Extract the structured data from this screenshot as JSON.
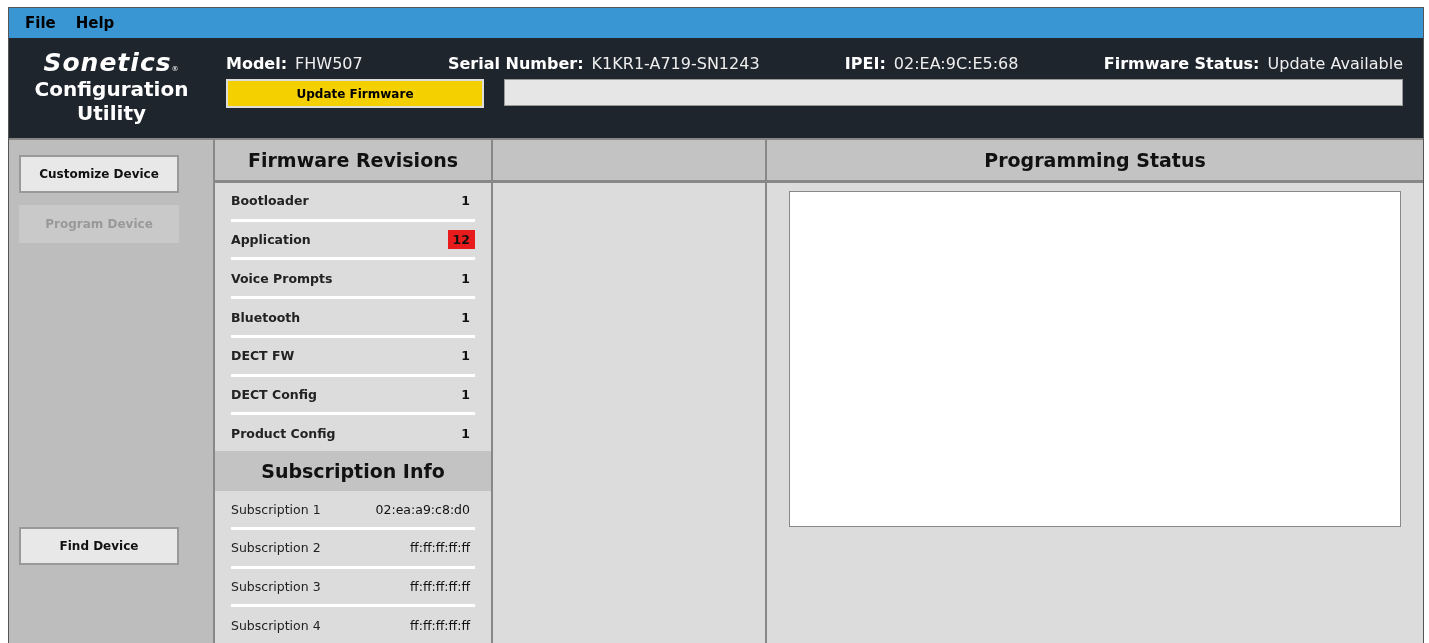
{
  "menu": [
    {
      "label": "File"
    },
    {
      "label": "Help"
    }
  ],
  "header": {
    "brand": "Sonetics",
    "brand_mark": "®",
    "subtitle": "Configuration Utility",
    "fields": [
      {
        "label": "Model:",
        "value": "FHW507"
      },
      {
        "label": "Serial Number:",
        "value": "K1KR1-A719-SN1243"
      },
      {
        "label": "IPEI:",
        "value": "02:EA:9C:E5:68"
      },
      {
        "label": "Firmware Status:",
        "value": "Update Available"
      }
    ],
    "update_button": {
      "label": "Update Firmware"
    },
    "progress": {
      "level": 0
    }
  },
  "sidebar": {
    "buttons": [
      {
        "label": "Customize Device",
        "disabled": false
      },
      {
        "label": "Program Device",
        "disabled": true
      }
    ],
    "find_button": {
      "label": "Find Device",
      "disabled": false
    }
  },
  "firmware": {
    "title": "Firmware Revisions",
    "rows": [
      {
        "name": "Bootloader",
        "value": "1",
        "outdated": false
      },
      {
        "name": "Application",
        "value": "12",
        "outdated": true
      },
      {
        "name": "Voice Prompts",
        "value": "1",
        "outdated": false
      },
      {
        "name": "Bluetooth",
        "value": "1",
        "outdated": false
      },
      {
        "name": "DECT FW",
        "value": "1",
        "outdated": false
      },
      {
        "name": "DECT Config",
        "value": "1",
        "outdated": false
      },
      {
        "name": "Product Config",
        "value": "1",
        "outdated": false
      }
    ]
  },
  "subscription": {
    "title": "Subscription Info",
    "rows": [
      {
        "name": "Subscription 1",
        "value": "02:ea:a9:c8:d0"
      },
      {
        "name": "Subscription 2",
        "value": "ff:ff:ff:ff:ff"
      },
      {
        "name": "Subscription 3",
        "value": "ff:ff:ff:ff:ff"
      },
      {
        "name": "Subscription 4",
        "value": "ff:ff:ff:ff:ff"
      }
    ]
  },
  "programming": {
    "title": "Programming Status"
  }
}
